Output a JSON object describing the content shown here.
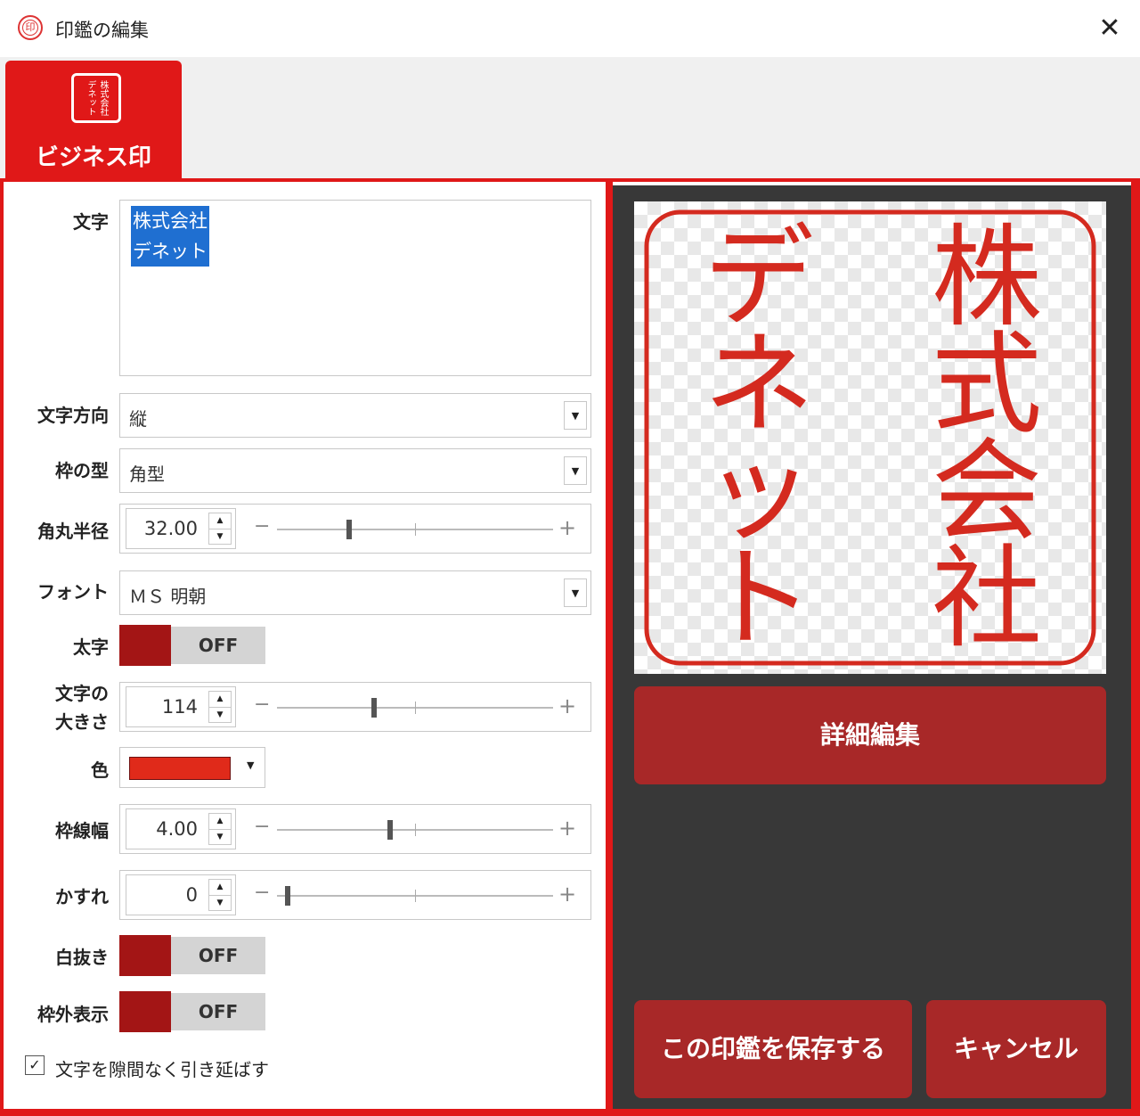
{
  "window": {
    "title": "印鑑の編集",
    "close_glyph": "✕",
    "icon_glyph": "印"
  },
  "tab": {
    "label": "ビジネス印",
    "icon_lines": [
      "株式会社",
      "デネット"
    ]
  },
  "form": {
    "text_label": "文字",
    "text_lines": [
      "株式会社",
      "デネット"
    ],
    "direction_label": "文字方向",
    "direction_value": "縦",
    "frame_type_label": "枠の型",
    "frame_type_value": "角型",
    "corner_radius_label": "角丸半径",
    "corner_radius_value": "32.00",
    "corner_radius_fraction": 0.26,
    "font_label": "フォント",
    "font_value": "ＭＳ 明朝",
    "bold_label": "太字",
    "bold_state": "OFF",
    "size_label_line1": "文字の",
    "size_label_line2": "大きさ",
    "size_value": "114",
    "size_fraction": 0.35,
    "color_label": "色",
    "color_value": "#e02a1a",
    "border_width_label": "枠線幅",
    "border_width_value": "4.00",
    "border_width_fraction": 0.41,
    "blur_label": "かすれ",
    "blur_value": "0",
    "blur_fraction": 0.04,
    "inverse_label": "白抜き",
    "inverse_state": "OFF",
    "outside_label": "枠外表示",
    "outside_state": "OFF",
    "stretch_checkbox_label": "文字を隙間なく引き延ばす",
    "stretch_checked": true,
    "minus_glyph": "−",
    "plus_glyph": "+",
    "arrow_up": "▲",
    "arrow_down": "▼",
    "combo_arrow": "▼",
    "check_glyph": "✓"
  },
  "preview": {
    "seal_color": "#d42a1f",
    "right_column": [
      "株",
      "式",
      "会",
      "社"
    ],
    "left_column": [
      "デ",
      "ネ",
      "ッ",
      "ト"
    ]
  },
  "buttons": {
    "detail_edit": "詳細編集",
    "save": "この印鑑を保存する",
    "cancel": "キャンセル"
  },
  "colors": {
    "accent": "#e01818",
    "button": "#a82828",
    "panel_dark": "#383838"
  }
}
